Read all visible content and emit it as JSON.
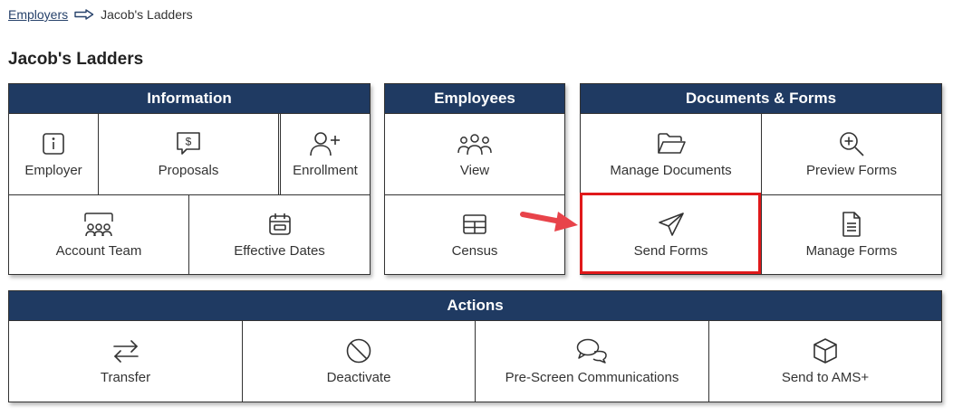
{
  "breadcrumb": {
    "parent": "Employers",
    "current": "Jacob's Ladders"
  },
  "page_title": "Jacob's Ladders",
  "panels": {
    "information": {
      "header": "Information",
      "tiles": {
        "employer": {
          "label": "Employer",
          "icon": "info-icon"
        },
        "proposals": {
          "label": "Proposals",
          "icon": "dollar-message-icon"
        },
        "enrollment": {
          "label": "Enrollment",
          "icon": "user-plus-icon"
        },
        "account_team": {
          "label": "Account Team",
          "icon": "team-icon"
        },
        "effective_dates": {
          "label": "Effective Dates",
          "icon": "calendar-icon"
        }
      }
    },
    "employees": {
      "header": "Employees",
      "tiles": {
        "view": {
          "label": "View",
          "icon": "users-icon"
        },
        "census": {
          "label": "Census",
          "icon": "table-icon"
        }
      }
    },
    "documents": {
      "header": "Documents & Forms",
      "tiles": {
        "manage_documents": {
          "label": "Manage Documents",
          "icon": "folder-open-icon"
        },
        "preview_forms": {
          "label": "Preview Forms",
          "icon": "zoom-in-icon"
        },
        "send_forms": {
          "label": "Send Forms",
          "icon": "send-icon"
        },
        "manage_forms": {
          "label": "Manage Forms",
          "icon": "document-icon"
        }
      }
    },
    "actions": {
      "header": "Actions",
      "tiles": {
        "transfer": {
          "label": "Transfer",
          "icon": "transfer-arrows-icon"
        },
        "deactivate": {
          "label": "Deactivate",
          "icon": "ban-icon"
        },
        "prescreen": {
          "label": "Pre-Screen Communications",
          "icon": "chat-icon"
        },
        "send_ams": {
          "label": "Send to AMS+",
          "icon": "box-icon"
        }
      }
    }
  },
  "colors": {
    "header_bg": "#1f3a62",
    "highlight": "#e0191b",
    "pointer": "#e8434a"
  }
}
